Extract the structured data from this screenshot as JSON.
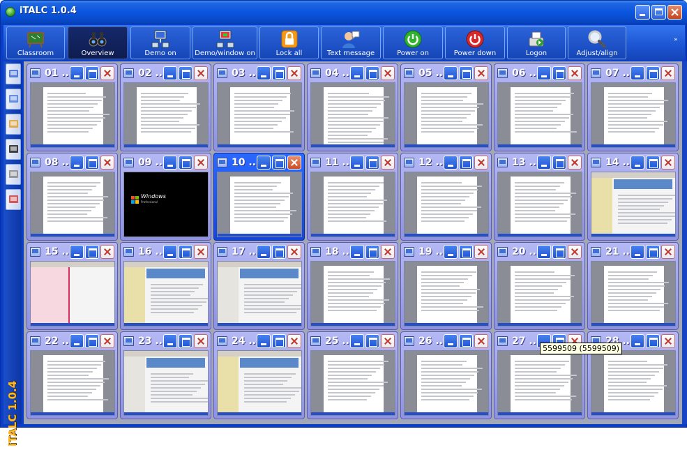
{
  "window": {
    "title": "iTALC 1.0.4"
  },
  "toolbar": {
    "items": [
      {
        "label": "Classroom",
        "icon": "classroom-icon",
        "active": false
      },
      {
        "label": "Overview",
        "icon": "binoculars-icon",
        "active": true
      },
      {
        "label": "Demo on",
        "icon": "demo-icon",
        "active": false
      },
      {
        "label": "Demo/window on",
        "icon": "demo-window-icon",
        "active": false
      },
      {
        "label": "Lock all",
        "icon": "lock-icon",
        "active": false
      },
      {
        "label": "Text message",
        "icon": "text-message-icon",
        "active": false
      },
      {
        "label": "Power on",
        "icon": "power-on-icon",
        "active": false
      },
      {
        "label": "Power down",
        "icon": "power-down-icon",
        "active": false
      },
      {
        "label": "Logon",
        "icon": "logon-icon",
        "active": false
      },
      {
        "label": "Adjust/align",
        "icon": "magnifier-icon",
        "active": false
      }
    ],
    "more": "»"
  },
  "sidebar": {
    "items": [
      "network-icon",
      "screen-icon",
      "users-icon",
      "snapshot-icon",
      "tools-icon",
      "docs-icon"
    ],
    "vertical_title": "iTALC 1.0.4"
  },
  "clients": [
    {
      "num": "01 ...",
      "kind": "doc"
    },
    {
      "num": "02 ...",
      "kind": "doc"
    },
    {
      "num": "03 ...",
      "kind": "doc"
    },
    {
      "num": "04 ...",
      "kind": "docwide"
    },
    {
      "num": "05 ...",
      "kind": "doc"
    },
    {
      "num": "06 ...",
      "kind": "doc"
    },
    {
      "num": "07 ...",
      "kind": "doc"
    },
    {
      "num": "08 ...",
      "kind": "doc"
    },
    {
      "num": "09 ...",
      "kind": "black"
    },
    {
      "num": "10 ...",
      "kind": "doc",
      "highlight": true
    },
    {
      "num": "11 ...",
      "kind": "doc"
    },
    {
      "num": "12 ...",
      "kind": "doc"
    },
    {
      "num": "13 ...",
      "kind": "doc"
    },
    {
      "num": "14 ...",
      "kind": "web"
    },
    {
      "num": "15 ...",
      "kind": "yahoo"
    },
    {
      "num": "16 ...",
      "kind": "web"
    },
    {
      "num": "17 ...",
      "kind": "web"
    },
    {
      "num": "18 ...",
      "kind": "doc"
    },
    {
      "num": "19 ...",
      "kind": "doc"
    },
    {
      "num": "20 ...",
      "kind": "doc"
    },
    {
      "num": "21 ...",
      "kind": "doc"
    },
    {
      "num": "22 ...",
      "kind": "doc"
    },
    {
      "num": "23 ...",
      "kind": "web"
    },
    {
      "num": "24 ...",
      "kind": "web"
    },
    {
      "num": "25 ...",
      "kind": "doc"
    },
    {
      "num": "26 ...",
      "kind": "doc"
    },
    {
      "num": "27 ...",
      "kind": "doc"
    },
    {
      "num": "28 ...",
      "kind": "doc"
    }
  ],
  "tooltip": "5599509 (5599509)",
  "windows_logo_text": "Windows",
  "windows_sub_text": "Professional"
}
